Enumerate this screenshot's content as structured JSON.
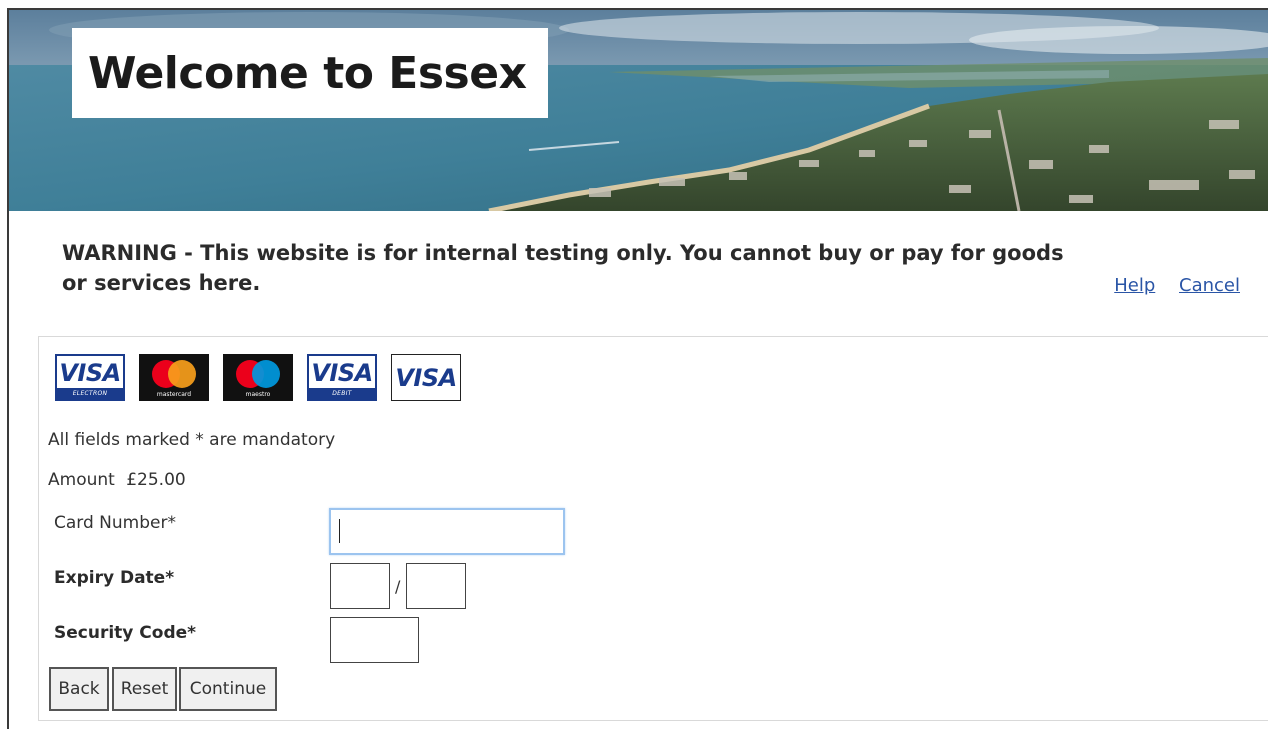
{
  "header": {
    "title": "Welcome to Essex"
  },
  "warning": {
    "text": "WARNING - This website is for internal testing only. You cannot buy or pay for goods or services here."
  },
  "links": {
    "help": "Help",
    "cancel": "Cancel"
  },
  "card_logos": [
    {
      "name": "visa-electron",
      "word": "VISA",
      "caption": "ELECTRON"
    },
    {
      "name": "mastercard",
      "caption": "mastercard"
    },
    {
      "name": "maestro",
      "caption": "maestro"
    },
    {
      "name": "visa-debit",
      "word": "VISA",
      "caption": "DEBIT"
    },
    {
      "name": "visa",
      "word": "VISA"
    }
  ],
  "form": {
    "mandatory_note": "All fields marked * are mandatory",
    "amount_label": "Amount",
    "amount_value": "£25.00",
    "card_number_label": "Card Number*",
    "card_number_value": "",
    "expiry_label": "Expiry Date*",
    "expiry_month_value": "",
    "expiry_separator": "/",
    "expiry_year_value": "",
    "security_label": "Security Code*",
    "security_value": ""
  },
  "buttons": {
    "back": "Back",
    "reset": "Reset",
    "continue": "Continue"
  },
  "colors": {
    "link": "#2a55a6",
    "focus_border": "#9cc4ef",
    "card_blue": "#1a3b8c",
    "mastercard_red": "#eb001b",
    "mastercard_orange": "#f79e1b",
    "maestro_blue": "#0099df"
  }
}
